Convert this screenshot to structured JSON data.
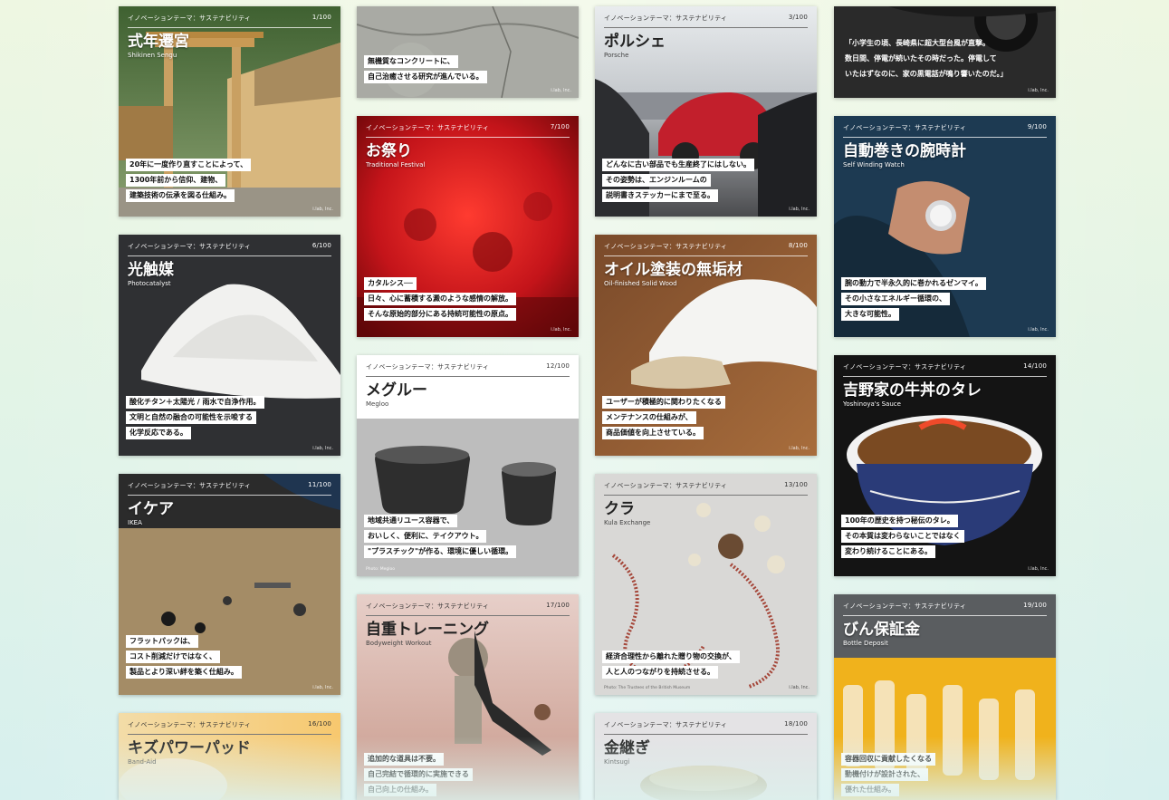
{
  "cards": [
    {
      "theme": "イノベーションテーマ：サステナビリティ",
      "num": "1/100",
      "title": "式年遷宮",
      "subtitle": "Shikinen Sengu",
      "lines": [
        "20年に一度作り直すことによって、",
        "1300年前から信仰、建物、",
        "建築技術の伝承を図る仕組み。"
      ],
      "brand": "i.lab, Inc.",
      "icon": "torii-shrine-photo"
    },
    {
      "theme": "",
      "num": "",
      "title": "",
      "subtitle": "",
      "lines": [
        "無機質なコンクリートに、",
        "自己治癒させる研究が進んでいる。"
      ],
      "brand": "i.lab, Inc.",
      "icon": "concrete-photo"
    },
    {
      "theme": "イノベーションテーマ：サステナビリティ",
      "num": "3/100",
      "title": "ポルシェ",
      "subtitle": "Porsche",
      "lines": [
        "どんなに古い部品でも生産終了にはしない。",
        "その姿勢は、エンジンルームの",
        "説明書きステッカーにまで至る。"
      ],
      "brand": "i.lab, Inc.",
      "icon": "porsche-photo"
    },
    {
      "theme": "",
      "num": "",
      "title": "",
      "subtitle": "",
      "lines": [
        "「小学生の頃、長崎県に超大型台風が直撃。",
        "数日間、停電が続いたその時だった。停電して",
        "いたはずなのに、家の黒電話が鳴り響いたのだ。」"
      ],
      "brand": "i.lab, Inc.",
      "icon": "telephone-photo"
    },
    {
      "theme": "イノベーションテーマ：サステナビリティ",
      "num": "6/100",
      "title": "光触媒",
      "subtitle": "Photocatalyst",
      "lines": [
        "酸化チタン＋太陽光 / 雨水で自浄作用。",
        "文明と自然の融合の可能性を示唆する",
        "化学反応である。"
      ],
      "brand": "i.lab, Inc.",
      "icon": "powder-photo"
    },
    {
      "theme": "イノベーションテーマ：サステナビリティ",
      "num": "7/100",
      "title": "お祭り",
      "subtitle": "Traditional Festival",
      "lines": [
        "カタルシス──",
        "日々、心に蓄積する澱のような感情の解放。",
        "そんな原始的部分にある持続可能性の原点。"
      ],
      "brand": "i.lab, Inc.",
      "icon": "festival-photo"
    },
    {
      "theme": "イノベーションテーマ：サステナビリティ",
      "num": "8/100",
      "title": "オイル塗装の無垢材",
      "subtitle": "Oil-finished Solid Wood",
      "lines": [
        "ユーザーが積極的に関わりたくなる",
        "メンテナンスの仕組みが、",
        "商品価値を向上させている。"
      ],
      "brand": "i.lab, Inc.",
      "icon": "glove-wood-photo"
    },
    {
      "theme": "イノベーションテーマ：サステナビリティ",
      "num": "9/100",
      "title": "自動巻きの腕時計",
      "subtitle": "Self Winding Watch",
      "lines": [
        "腕の動力で半永久的に巻かれるゼンマイ。",
        "その小さなエネルギー循環の、",
        "大きな可能性。"
      ],
      "brand": "i.lab, Inc.",
      "icon": "wristwatch-photo"
    },
    {
      "theme": "イノベーションテーマ：サステナビリティ",
      "num": "11/100",
      "title": "イケア",
      "subtitle": "IKEA",
      "lines": [
        "フラットパックは、",
        "コスト削減だけではなく、",
        "製品とより深い絆を築く仕組み。"
      ],
      "brand": "i.lab, Inc.",
      "icon": "flatpack-photo"
    },
    {
      "theme": "イノベーションテーマ：サステナビリティ",
      "num": "12/100",
      "title": "メグルー",
      "subtitle": "Megloo",
      "lines": [
        "地域共通リユース容器で、",
        "おいしく、便利に、テイクアウト。",
        "\"プラスチック\"が作る、環境に優しい循環。"
      ],
      "brand": "",
      "credit": "Photo: Megloo",
      "icon": "container-photo"
    },
    {
      "theme": "イノベーションテーマ：サステナビリティ",
      "num": "13/100",
      "title": "クラ",
      "subtitle": "Kula Exchange",
      "lines": [
        "経済合理性から離れた贈り物の交換が、",
        "人と人のつながりを持続させる。"
      ],
      "brand": "i.lab, Inc.",
      "credit": "Photo: The Trustees of the British Museum",
      "icon": "necklace-photo"
    },
    {
      "theme": "イノベーションテーマ：サステナビリティ",
      "num": "14/100",
      "title": "吉野家の牛丼のタレ",
      "subtitle": "Yoshinoya's Sauce",
      "lines": [
        "100年の歴史を持つ秘伝のタレ。",
        "その本質は変わらないことではなく",
        "変わり続けることにある。"
      ],
      "brand": "i.lab, Inc.",
      "icon": "gyudon-photo"
    },
    {
      "theme": "イノベーションテーマ：サステナビリティ",
      "num": "16/100",
      "title": "キズパワーパッド",
      "subtitle": "Band-Aid",
      "lines": [],
      "brand": "",
      "icon": "bandaid-photo"
    },
    {
      "theme": "イノベーションテーマ：サステナビリティ",
      "num": "17/100",
      "title": "自重トレーニング",
      "subtitle": "Bodyweight Workout",
      "lines": [
        "追加的な道具は不要。",
        "自己完結で循環的に実施できる",
        "自己向上の仕組み。"
      ],
      "brand": "",
      "icon": "pushup-photo"
    },
    {
      "theme": "イノベーションテーマ：サステナビリティ",
      "num": "18/100",
      "title": "金継ぎ",
      "subtitle": "Kintsugi",
      "lines": [],
      "brand": "",
      "icon": "bowl-photo"
    },
    {
      "theme": "イノベーションテーマ：サステナビリティ",
      "num": "19/100",
      "title": "びん保証金",
      "subtitle": "Bottle Deposit",
      "lines": [
        "容器回収に貢献したくなる",
        "動機付けが設計された、",
        "優れた仕組み。"
      ],
      "brand": "",
      "icon": "bottles-photo"
    }
  ]
}
